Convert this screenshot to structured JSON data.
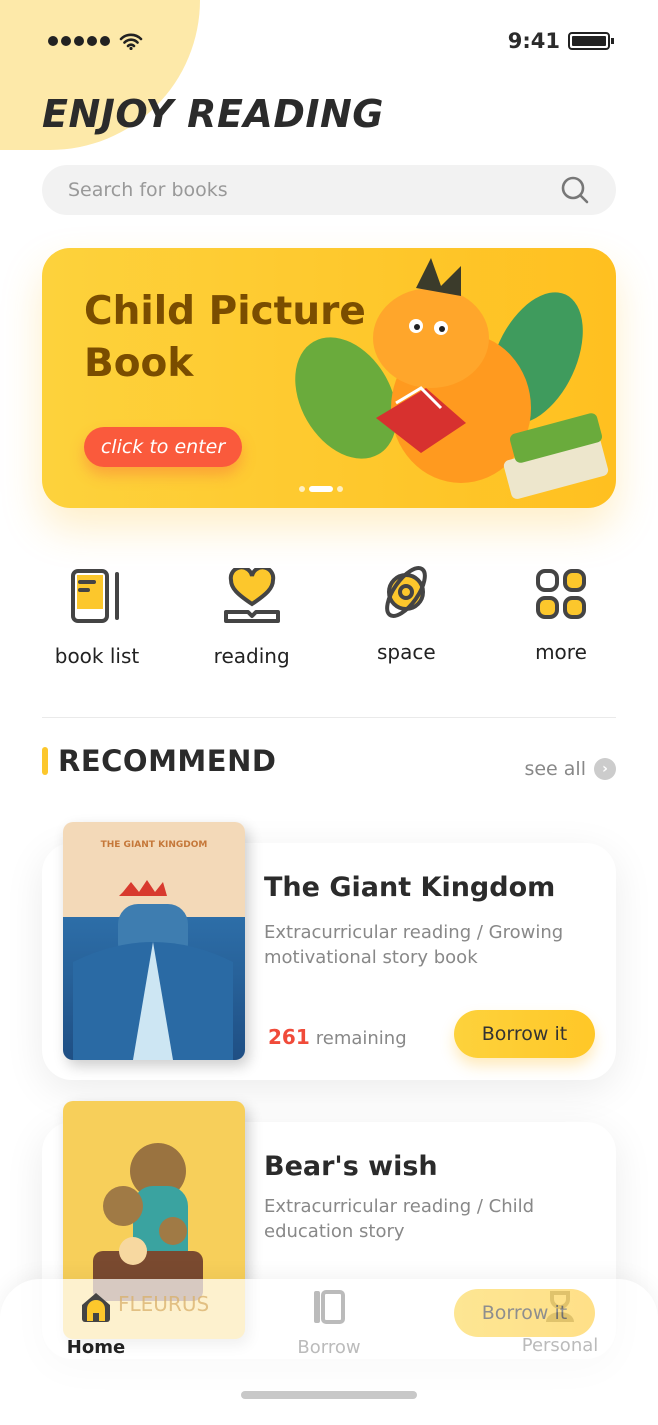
{
  "status_bar": {
    "time": "9:41",
    "signal_icon": "signal-dots-icon",
    "wifi_icon": "wifi-icon",
    "battery_icon": "battery-icon"
  },
  "header": {
    "title": "ENJOY READING"
  },
  "search": {
    "placeholder": "Search for books",
    "icon": "search-icon"
  },
  "banner": {
    "title": "Child Picture Book",
    "button": "click to enter",
    "pages": 3,
    "active_page": 2
  },
  "categories": [
    {
      "label": "book list",
      "icon": "book-list-icon"
    },
    {
      "label": "reading",
      "icon": "heart-book-icon"
    },
    {
      "label": "space",
      "icon": "planet-icon"
    },
    {
      "label": "more",
      "icon": "grid-icon"
    }
  ],
  "recommend": {
    "title": "RECOMMEND",
    "see_all": "see all"
  },
  "books": [
    {
      "title": "The Giant Kingdom",
      "description": "Extracurricular reading / Growing motivational story book",
      "remaining_count": "261",
      "remaining_label": "remaining",
      "button": "Borrow it",
      "cover_text": "THE GIANT KINGDOM"
    },
    {
      "title": "Bear's wish",
      "description": "Extracurricular reading  / Child education story",
      "button": "Borrow it",
      "cover_text": "FLEURUS"
    }
  ],
  "tabbar": [
    {
      "label": "Home",
      "icon": "home-icon",
      "active": true
    },
    {
      "label": "Borrow",
      "icon": "book-icon",
      "active": false
    },
    {
      "label": "Personal",
      "icon": "person-icon",
      "active": false
    }
  ],
  "colors": {
    "accent": "#fcc72c",
    "danger": "#f04b3a",
    "button_red": "#fa5a3c",
    "text": "#2b2b2b"
  }
}
